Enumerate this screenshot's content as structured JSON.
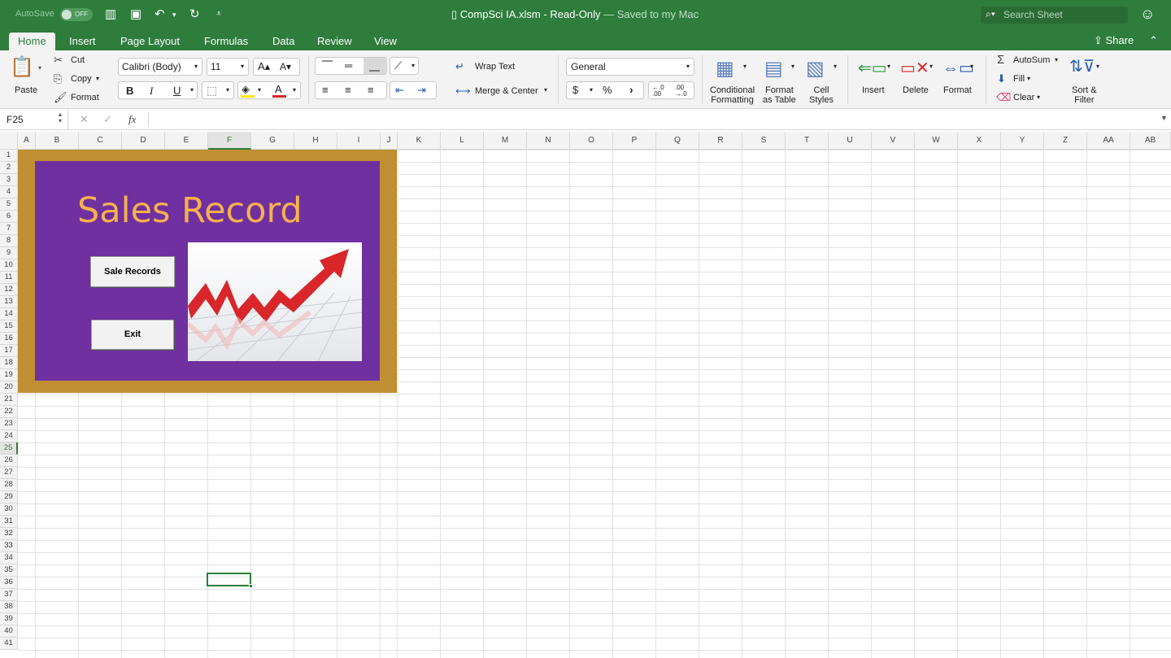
{
  "titlebar": {
    "autosave_label": "AutoSave",
    "autosave_state": "OFF",
    "doc_name": "CompSci IA.xlsm",
    "doc_sep": "-",
    "doc_mode": "Read-Only",
    "doc_status": "— Saved to my Mac",
    "search_placeholder": "Search Sheet"
  },
  "tabs": [
    "Home",
    "Insert",
    "Page Layout",
    "Formulas",
    "Data",
    "Review",
    "View"
  ],
  "share_label": "Share",
  "ribbon": {
    "paste": "Paste",
    "cut": "Cut",
    "copy": "Copy",
    "format_painter": "Format",
    "font_name": "Calibri (Body)",
    "font_size": "11",
    "bold": "B",
    "italic": "I",
    "underline": "U",
    "wrap_text": "Wrap Text",
    "merge_center": "Merge & Center",
    "number_format": "General",
    "currency": "$",
    "percent": "%",
    "comma": "›",
    "cond_fmt_1": "Conditional",
    "cond_fmt_2": "Formatting",
    "fmt_table_1": "Format",
    "fmt_table_2": "as Table",
    "cell_styles_1": "Cell",
    "cell_styles_2": "Styles",
    "insert": "Insert",
    "delete": "Delete",
    "format": "Format",
    "autosum": "AutoSum",
    "fill": "Fill",
    "clear": "Clear",
    "sort_1": "Sort &",
    "sort_2": "Filter"
  },
  "formula_bar": {
    "name_box": "F25",
    "fx": "fx",
    "content": ""
  },
  "columns": [
    "A",
    "B",
    "C",
    "D",
    "E",
    "F",
    "G",
    "H",
    "I",
    "J",
    "K",
    "L",
    "M",
    "N",
    "O",
    "P",
    "Q",
    "R",
    "S",
    "T",
    "U",
    "V",
    "W",
    "X",
    "Y",
    "Z",
    "AA",
    "AB"
  ],
  "rows": [
    "1",
    "2",
    "3",
    "4",
    "5",
    "6",
    "7",
    "8",
    "9",
    "10",
    "11",
    "12",
    "13",
    "14",
    "15",
    "16",
    "17",
    "18",
    "19",
    "20",
    "21",
    "22",
    "23",
    "24",
    "25",
    "26",
    "27",
    "28",
    "29",
    "30",
    "31",
    "32",
    "33",
    "34",
    "35",
    "36",
    "37",
    "38",
    "39",
    "40",
    "41"
  ],
  "selected_cell": {
    "column": "F",
    "row": "25"
  },
  "sheet_form": {
    "title": "Sales Record",
    "button_records": "Sale Records",
    "button_exit": "Exit"
  },
  "colors": {
    "excel_green": "#2e7d3c",
    "frame_gold": "#c08f31",
    "panel_purple": "#7030a0",
    "title_orange": "#f5b14d",
    "arrow_red": "#d8262a"
  }
}
